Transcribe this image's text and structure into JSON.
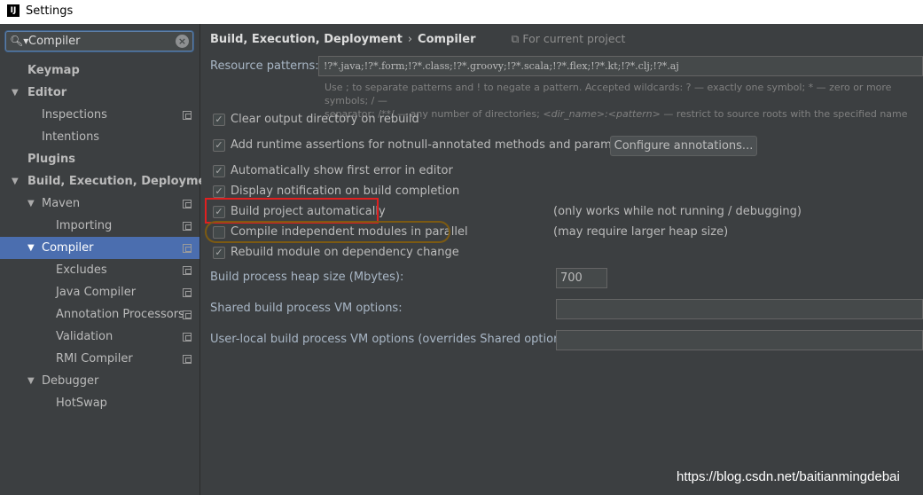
{
  "window": {
    "title": "Settings",
    "app_icon": "IJ"
  },
  "search": {
    "value": "Compiler"
  },
  "sidebar": {
    "items": [
      {
        "label": "Keymap",
        "bold": true,
        "indent": 0,
        "arrow": "",
        "pico": false,
        "selected": false
      },
      {
        "label": "Editor",
        "bold": true,
        "indent": 0,
        "arrow": "▼",
        "pico": false,
        "selected": false
      },
      {
        "label": "Inspections",
        "bold": false,
        "indent": 1,
        "arrow": "",
        "pico": true,
        "selected": false
      },
      {
        "label": "Intentions",
        "bold": false,
        "indent": 1,
        "arrow": "",
        "pico": false,
        "selected": false
      },
      {
        "label": "Plugins",
        "bold": true,
        "indent": 0,
        "arrow": "",
        "pico": false,
        "selected": false
      },
      {
        "label": "Build, Execution, Deployment",
        "bold": true,
        "indent": 0,
        "arrow": "▼",
        "pico": false,
        "selected": false
      },
      {
        "label": "Maven",
        "bold": false,
        "indent": 1,
        "arrow": "▼",
        "pico": true,
        "selected": false
      },
      {
        "label": "Importing",
        "bold": false,
        "indent": 2,
        "arrow": "",
        "pico": true,
        "selected": false
      },
      {
        "label": "Compiler",
        "bold": false,
        "indent": 1,
        "arrow": "▼",
        "pico": true,
        "selected": true
      },
      {
        "label": "Excludes",
        "bold": false,
        "indent": 2,
        "arrow": "",
        "pico": true,
        "selected": false
      },
      {
        "label": "Java Compiler",
        "bold": false,
        "indent": 2,
        "arrow": "",
        "pico": true,
        "selected": false
      },
      {
        "label": "Annotation Processors",
        "bold": false,
        "indent": 2,
        "arrow": "",
        "pico": true,
        "selected": false
      },
      {
        "label": "Validation",
        "bold": false,
        "indent": 2,
        "arrow": "",
        "pico": true,
        "selected": false
      },
      {
        "label": "RMI Compiler",
        "bold": false,
        "indent": 2,
        "arrow": "",
        "pico": true,
        "selected": false
      },
      {
        "label": "Debugger",
        "bold": false,
        "indent": 1,
        "arrow": "▼",
        "pico": false,
        "selected": false
      },
      {
        "label": "HotSwap",
        "bold": false,
        "indent": 2,
        "arrow": "",
        "pico": false,
        "selected": false
      }
    ]
  },
  "breadcrumb": {
    "section": "Build, Execution, Deployment",
    "separator": "›",
    "page": "Compiler",
    "scope": "For current project"
  },
  "resource_patterns": {
    "label": "Resource patterns:",
    "value": "!?*.java;!?*.form;!?*.class;!?*.groovy;!?*.scala;!?*.flex;!?*.kt;!?*.clj;!?*.aj",
    "hint_line1": "Use ; to separate patterns and ! to negate a pattern. Accepted wildcards: ? — exactly one symbol; * — zero or more symbols; / —",
    "hint_line2_a": "separator; /**/ — any number of directories; ",
    "hint_line2_b": "<dir_name>:<pattern>",
    "hint_line2_c": " — restrict to source roots with the specified name"
  },
  "options": {
    "clear_output": {
      "label": "Clear output directory on rebuild",
      "checked": true
    },
    "runtime_assertions": {
      "label": "Add runtime assertions for notnull-annotated methods and parameters",
      "checked": true
    },
    "configure_annotations": "Configure annotations...",
    "show_first_error": {
      "label": "Automatically show first error in editor",
      "checked": true
    },
    "display_notification": {
      "label": "Display notification on build completion",
      "checked": true
    },
    "build_automatically": {
      "label": "Build project automatically",
      "checked": true,
      "note": "(only works while not running / debugging)"
    },
    "compile_parallel": {
      "label": "Compile independent modules in parallel",
      "checked": false,
      "note": "(may require larger heap size)"
    },
    "rebuild_module": {
      "label": "Rebuild module on dependency change",
      "checked": true
    }
  },
  "heap_size": {
    "label": "Build process heap size (Mbytes):",
    "value": "700"
  },
  "shared_vm": {
    "label": "Shared build process VM options:",
    "value": ""
  },
  "user_vm": {
    "label": "User-local build process VM options (overrides Shared options):",
    "value": ""
  },
  "watermark": "https://blog.csdn.net/baitianmingdebai",
  "colors": {
    "selection": "#4b6eaf",
    "highlight_red": "#e02020",
    "highlight_gold": "#7c5a12"
  }
}
